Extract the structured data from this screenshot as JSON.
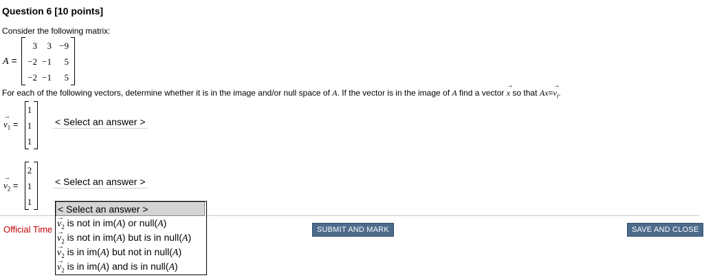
{
  "question": {
    "title": "Question 6 [10 points]",
    "intro": "Consider the following matrix:",
    "matrix_symbol": "A",
    "equals": "=",
    "matrix": [
      [
        "3",
        "3",
        "−9"
      ],
      [
        "−2",
        "−1",
        "5"
      ],
      [
        "−2",
        "−1",
        "5"
      ]
    ],
    "instructions_a": "For each of the following vectors, determine whether it is in the image and/or null space of ",
    "instructions_b": "A",
    "instructions_c": ". If the vector is in the image of ",
    "instructions_d": "A",
    "instructions_e": " find a vector ",
    "instructions_f": "x",
    "instructions_g": " so that ",
    "instructions_h": "Ax",
    "instructions_i": "=",
    "instructions_j": "v",
    "instructions_k": "i",
    "instructions_l": "."
  },
  "vectors": [
    {
      "label_base": "v",
      "label_sub": "1",
      "equals": "=",
      "entries": [
        "1",
        "1",
        "1"
      ],
      "select_value": "< Select an answer >"
    },
    {
      "label_base": "v",
      "label_sub": "2",
      "equals": "=",
      "entries": [
        "2",
        "1",
        "1"
      ],
      "select_value": "< Select an answer >"
    }
  ],
  "dropdown": {
    "header": "< Select an answer >",
    "options": [
      {
        "vec": "v",
        "sub": "2",
        "text": " is not in im(",
        "m1": "A",
        "mid": ") or null(",
        "m2": "A",
        "end": ")"
      },
      {
        "vec": "v",
        "sub": "2",
        "text": " is not in im(",
        "m1": "A",
        "mid": ") but is in null(",
        "m2": "A",
        "end": ")"
      },
      {
        "vec": "v",
        "sub": "2",
        "text": " is in im(",
        "m1": "A",
        "mid": ") but not in null(",
        "m2": "A",
        "end": ")"
      },
      {
        "vec": "v",
        "sub": "2",
        "text": " is in im(",
        "m1": "A",
        "mid": ") and is in null(",
        "m2": "A",
        "end": ")"
      }
    ]
  },
  "footer": {
    "official_time": "Official Time",
    "submit_label": "SUBMIT AND MARK",
    "save_label": "SAVE AND CLOSE"
  },
  "colors": {
    "button_bg": "#4d6b8c",
    "official_time": "#c00000",
    "selected_option_bg": "#d4d4d4"
  }
}
